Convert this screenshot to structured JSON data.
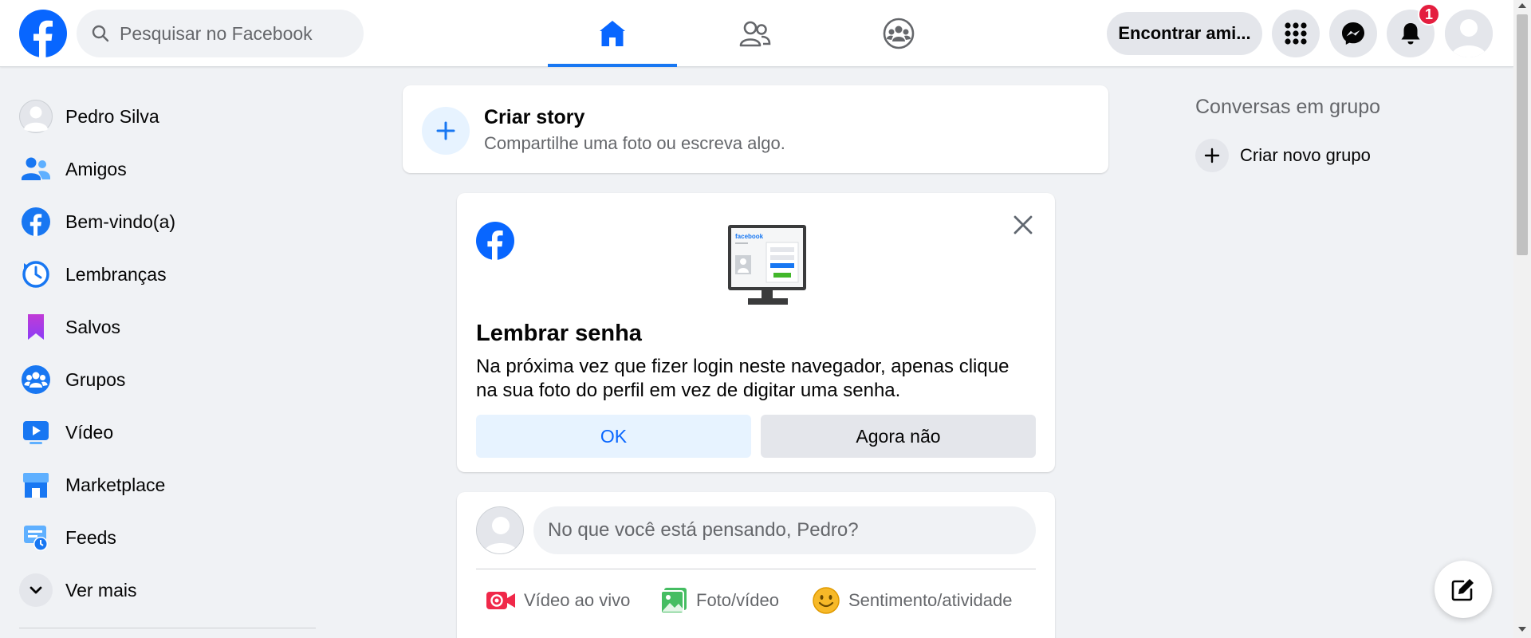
{
  "header": {
    "search_placeholder": "Pesquisar no Facebook",
    "find_friends_label": "Encontrar ami...",
    "notification_count": "1",
    "tabs": [
      {
        "icon": "home-icon",
        "active": true
      },
      {
        "icon": "friends-icon",
        "active": false
      },
      {
        "icon": "groups-icon",
        "active": false
      }
    ]
  },
  "sidebar": {
    "items": [
      {
        "label": "Pedro Silva",
        "icon": "avatar"
      },
      {
        "label": "Amigos",
        "icon": "friends-icon"
      },
      {
        "label": "Bem-vindo(a)",
        "icon": "facebook-icon"
      },
      {
        "label": "Lembranças",
        "icon": "clock-icon"
      },
      {
        "label": "Salvos",
        "icon": "bookmark-icon"
      },
      {
        "label": "Grupos",
        "icon": "groups-icon"
      },
      {
        "label": "Vídeo",
        "icon": "video-icon"
      },
      {
        "label": "Marketplace",
        "icon": "store-icon"
      },
      {
        "label": "Feeds",
        "icon": "feeds-icon"
      },
      {
        "label": "Ver mais",
        "icon": "chevron-down-icon"
      }
    ]
  },
  "story": {
    "title": "Criar story",
    "subtitle": "Compartilhe uma foto ou escreva algo."
  },
  "password_card": {
    "title": "Lembrar senha",
    "text": "Na próxima vez que fizer login neste navegador, apenas clique na sua foto do perfil em vez de digitar uma senha.",
    "ok_label": "OK",
    "not_now_label": "Agora não",
    "illustration_brand": "facebook"
  },
  "composer": {
    "placeholder": "No que você está pensando, Pedro?",
    "actions": [
      {
        "label": "Vídeo ao vivo",
        "icon": "live-video-icon",
        "color": "#f02849"
      },
      {
        "label": "Foto/vídeo",
        "icon": "photo-icon",
        "color": "#45bd62"
      },
      {
        "label": "Sentimento/atividade",
        "icon": "emoji-icon",
        "color": "#f7b928"
      }
    ]
  },
  "right": {
    "title": "Conversas em grupo",
    "create_group_label": "Criar novo grupo"
  },
  "colors": {
    "brand": "#1877f2",
    "background": "#f0f2f5",
    "badge": "#e41e3f"
  }
}
